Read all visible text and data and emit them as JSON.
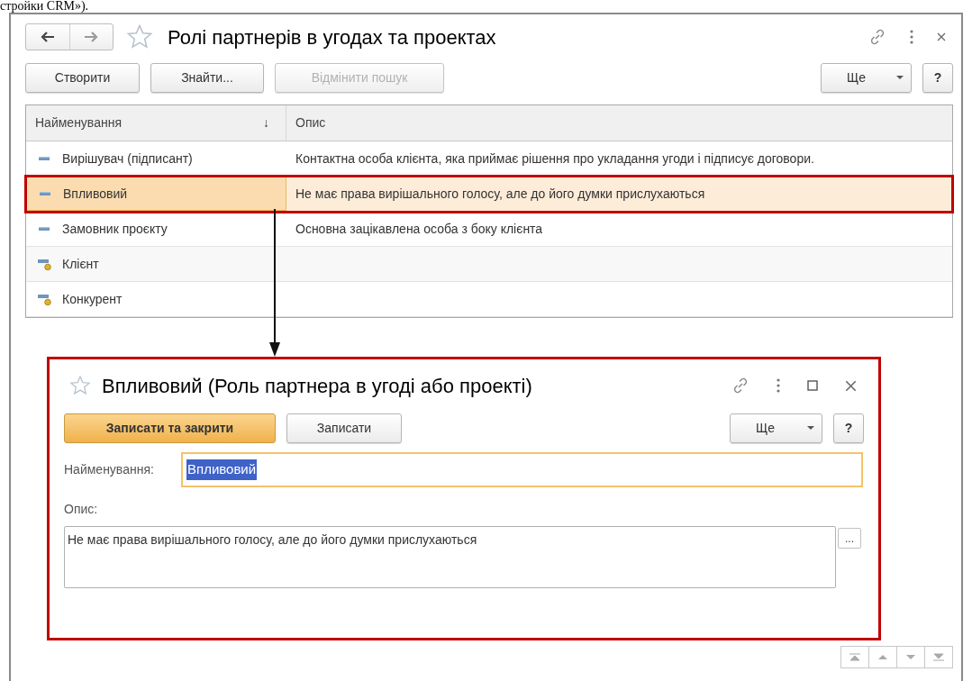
{
  "caption_fragment": "стройки CRM»).",
  "list_window": {
    "title": "Ролі партнерів в угодах та проектах",
    "toolbar": {
      "create": "Створити",
      "find": "Знайти...",
      "cancel_search": {
        "label": "Відмінити пошук",
        "disabled": true
      },
      "more": "Ще",
      "help": "?"
    },
    "table": {
      "columns": [
        {
          "label": "Найменування",
          "sort_icon": "↓"
        },
        {
          "label": "Опис"
        }
      ],
      "rows": [
        {
          "kind": "item",
          "name": "Вирішувач (підписант)",
          "description": "Контактна особа клієнта, яка приймає рішення про укладання угоди і підписує договори.",
          "selected": false
        },
        {
          "kind": "item",
          "name": "Впливовий",
          "description": "Не має права вирішального голосу, але до його думки прислухаються",
          "selected": true
        },
        {
          "kind": "item",
          "name": "Замовник проєкту",
          "description": "Основна зацікавлена особа з боку клієнта",
          "selected": false
        },
        {
          "kind": "predefined",
          "name": "Клієнт",
          "selected": false
        },
        {
          "kind": "predefined",
          "name": "Конкурент",
          "selected": false
        }
      ]
    }
  },
  "form_window": {
    "title": "Впливовий (Роль партнера в угоді або проекті)",
    "buttons": {
      "save_close": "Записати та закрити",
      "save": "Записати",
      "more": "Ще",
      "help": "?"
    },
    "name_field": {
      "label": "Найменування:",
      "value": "Впливовий"
    },
    "description_field": {
      "label": "Опис:",
      "value": "Не має права вирішального голосу, але до його думки прислухаються",
      "choose": "..."
    }
  }
}
